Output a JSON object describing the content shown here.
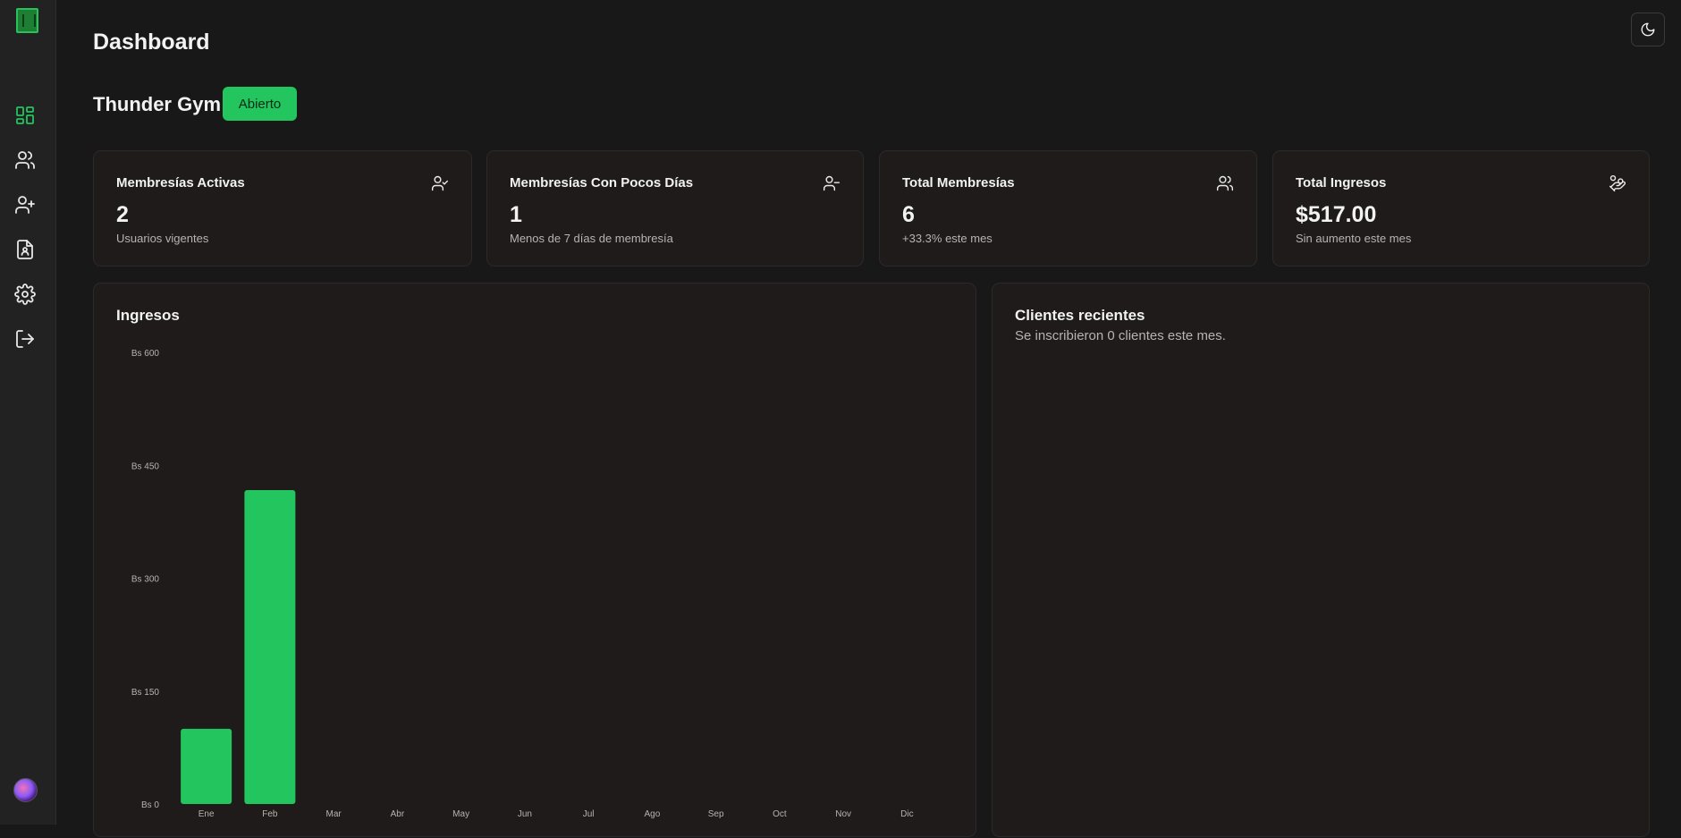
{
  "header": {
    "title": "Dashboard",
    "theme_toggle_icon": "moon-icon"
  },
  "sidebar": {
    "logo_icon": "app-logo-icon",
    "items": [
      {
        "name": "dashboard",
        "icon": "layout-grid-icon",
        "active": true
      },
      {
        "name": "users",
        "icon": "users-icon",
        "active": false
      },
      {
        "name": "add-user",
        "icon": "user-plus-icon",
        "active": false
      },
      {
        "name": "reports",
        "icon": "file-user-icon",
        "active": false
      },
      {
        "name": "settings",
        "icon": "gear-icon",
        "active": false
      },
      {
        "name": "logout",
        "icon": "logout-icon",
        "active": false
      }
    ],
    "accent": "#22c55e"
  },
  "gym": {
    "name": "Thunder Gym",
    "status": "Abierto",
    "status_color": "#22c55e"
  },
  "cards": [
    {
      "title": "Membresías Activas",
      "value": "2",
      "subtitle": "Usuarios vigentes",
      "icon": "user-check-icon"
    },
    {
      "title": "Membresías Con Pocos Días",
      "value": "1",
      "subtitle": "Menos de 7 días de membresía",
      "icon": "user-minus-icon"
    },
    {
      "title": "Total Membresías",
      "value": "6",
      "subtitle": "+33.3% este mes",
      "icon": "users-icon"
    },
    {
      "title": "Total Ingresos",
      "value": "$517.00",
      "subtitle": "Sin aumento este mes",
      "icon": "hand-coins-icon"
    }
  ],
  "income_panel": {
    "title": "Ingresos"
  },
  "recent_panel": {
    "title": "Clientes recientes",
    "subtitle": "Se inscribieron 0 clientes este mes."
  },
  "chart_data": {
    "type": "bar",
    "title": "Ingresos",
    "categories": [
      "Ene",
      "Feb",
      "Mar",
      "Abr",
      "May",
      "Jun",
      "Jul",
      "Ago",
      "Sep",
      "Oct",
      "Nov",
      "Dic"
    ],
    "values": [
      100,
      417,
      0,
      0,
      0,
      0,
      0,
      0,
      0,
      0,
      0,
      0
    ],
    "ytick_labels": [
      "Bs 0",
      "Bs 150",
      "Bs 300",
      "Bs 450",
      "Bs 600"
    ],
    "yticks": [
      0,
      150,
      300,
      450,
      600
    ],
    "ylim": [
      0,
      600
    ],
    "bar_color": "#22c55e",
    "grid": false,
    "legend": "none"
  }
}
